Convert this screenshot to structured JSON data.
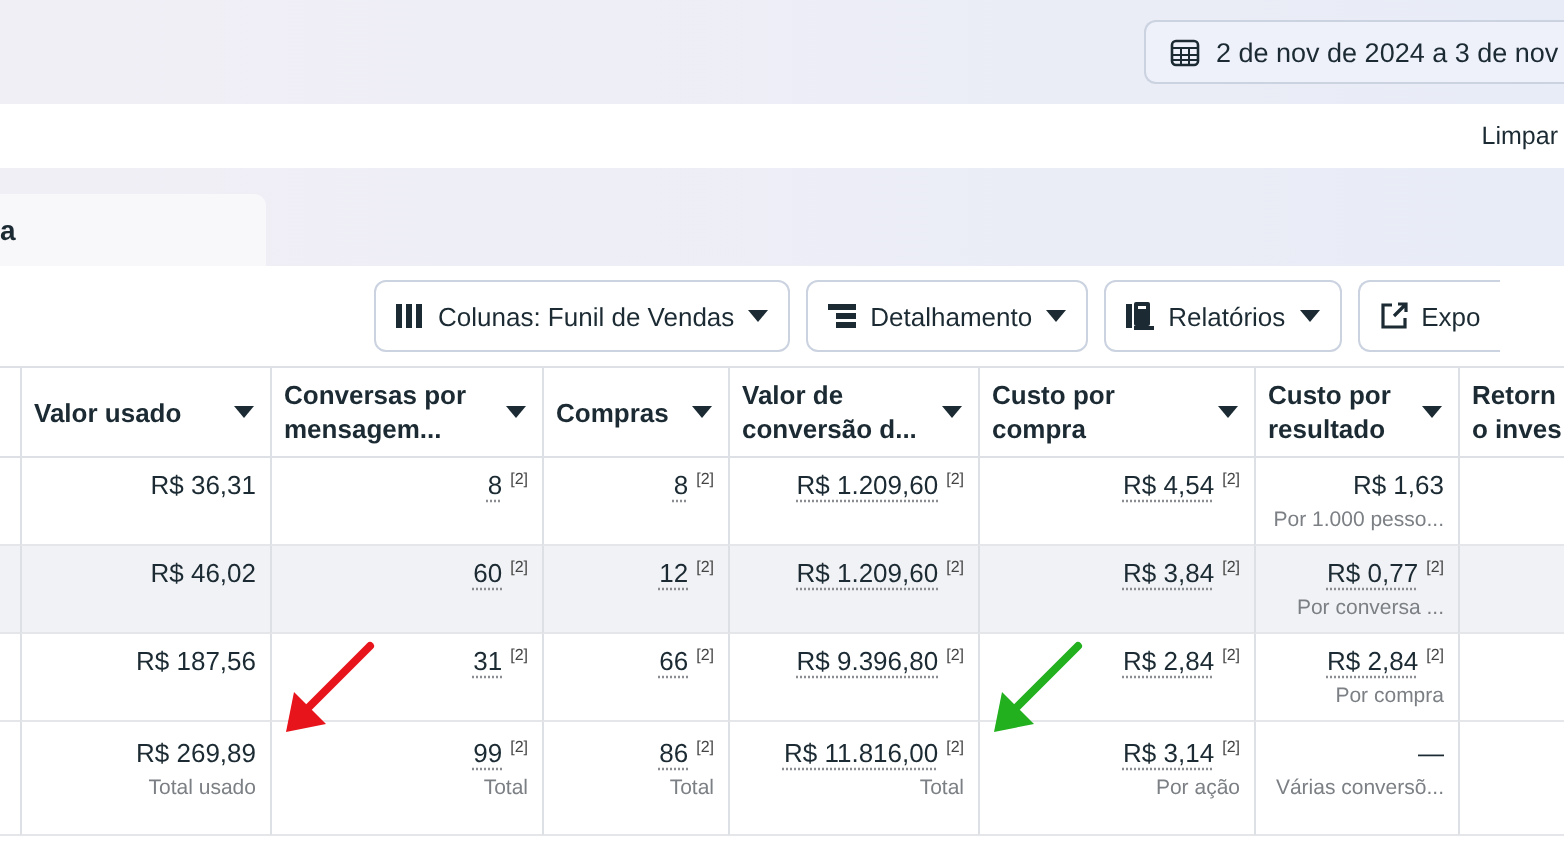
{
  "date_range": {
    "label": "2 de nov de 2024 a 3 de nov"
  },
  "filter_bar": {
    "clear_label": "Limpar"
  },
  "tabs": [
    {
      "label": "a",
      "selected": true
    }
  ],
  "toolbar": [
    {
      "kind": "columns",
      "label": "Colunas: Funil de Vendas"
    },
    {
      "kind": "breakdown",
      "label": "Detalhamento"
    },
    {
      "kind": "reports",
      "label": "Relatórios"
    },
    {
      "kind": "export",
      "label": "Expo"
    }
  ],
  "table": {
    "columns": [
      {
        "lines": [
          "Valor usado"
        ],
        "sortable": true
      },
      {
        "lines": [
          "Conversas por",
          "mensagem..."
        ],
        "sortable": true
      },
      {
        "lines": [
          "Compras"
        ],
        "sortable": true
      },
      {
        "lines": [
          "Valor de",
          "conversão d..."
        ],
        "sortable": true
      },
      {
        "lines": [
          "Custo por",
          "compra"
        ],
        "sortable": true
      },
      {
        "lines": [
          "Custo por",
          "resultado"
        ],
        "sortable": true
      },
      {
        "lines": [
          "Retorn",
          "o inves"
        ],
        "sortable": false
      }
    ],
    "rows": [
      {
        "highlighted": false,
        "cells": [
          {
            "value": "R$ 36,31",
            "underlined": false
          },
          {
            "value": "8",
            "footnote": "[2]",
            "underlined": true
          },
          {
            "value": "8",
            "footnote": "[2]",
            "underlined": true
          },
          {
            "value": "R$ 1.209,60",
            "footnote": "[2]",
            "underlined": true
          },
          {
            "value": "R$ 4,54",
            "footnote": "[2]",
            "underlined": true
          },
          {
            "value": "R$ 1,63",
            "underlined": false,
            "sub": "Por 1.000 pesso..."
          }
        ]
      },
      {
        "highlighted": true,
        "cells": [
          {
            "value": "R$ 46,02",
            "underlined": false
          },
          {
            "value": "60",
            "footnote": "[2]",
            "underlined": true
          },
          {
            "value": "12",
            "footnote": "[2]",
            "underlined": true
          },
          {
            "value": "R$ 1.209,60",
            "footnote": "[2]",
            "underlined": true
          },
          {
            "value": "R$ 3,84",
            "footnote": "[2]",
            "underlined": true
          },
          {
            "value": "R$ 0,77",
            "footnote": "[2]",
            "underlined": true,
            "sub": "Por conversa ..."
          }
        ]
      },
      {
        "highlighted": false,
        "cells": [
          {
            "value": "R$ 187,56",
            "underlined": false
          },
          {
            "value": "31",
            "footnote": "[2]",
            "underlined": true
          },
          {
            "value": "66",
            "footnote": "[2]",
            "underlined": true
          },
          {
            "value": "R$ 9.396,80",
            "footnote": "[2]",
            "underlined": true
          },
          {
            "value": "R$ 2,84",
            "footnote": "[2]",
            "underlined": true
          },
          {
            "value": "R$ 2,84",
            "footnote": "[2]",
            "underlined": true,
            "sub": "Por compra"
          }
        ]
      }
    ],
    "totals": [
      {
        "value": "R$ 269,89",
        "underlined": false,
        "sub": "Total usado"
      },
      {
        "value": "99",
        "footnote": "[2]",
        "underlined": true,
        "sub": "Total"
      },
      {
        "value": "86",
        "footnote": "[2]",
        "underlined": true,
        "sub": "Total"
      },
      {
        "value": "R$ 11.816,00",
        "footnote": "[2]",
        "underlined": true,
        "sub": "Total"
      },
      {
        "value": "R$ 3,14",
        "footnote": "[2]",
        "underlined": true,
        "sub": "Por ação"
      },
      {
        "value": "—",
        "underlined": false,
        "sub": "Várias conversõ..."
      }
    ]
  },
  "annotations": [
    {
      "color": "#e8141b"
    },
    {
      "color": "#22b01f"
    }
  ]
}
